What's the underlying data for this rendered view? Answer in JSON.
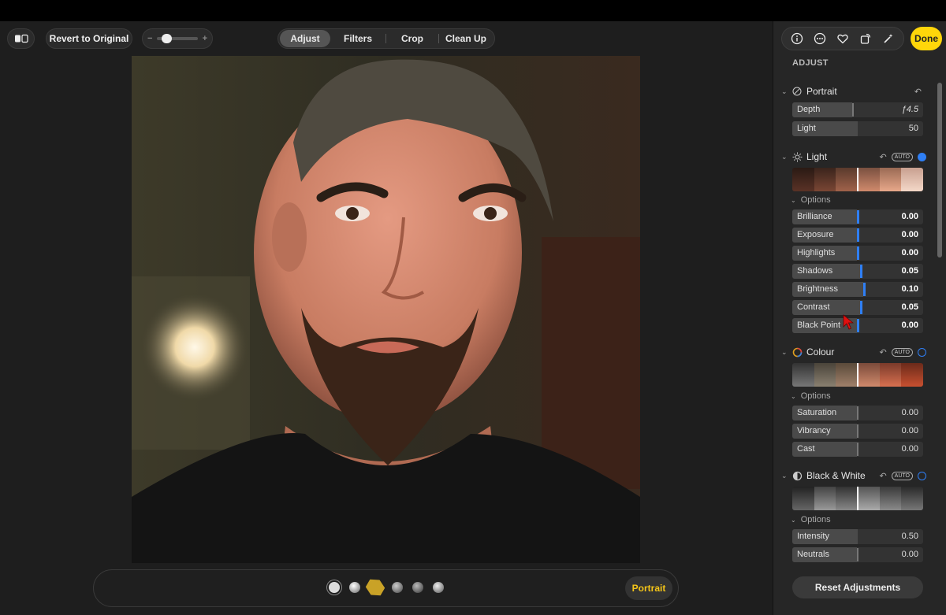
{
  "toolbar": {
    "revert_label": "Revert to Original",
    "tabs": [
      "Adjust",
      "Filters",
      "Crop",
      "Clean Up"
    ],
    "active_tab": "Adjust",
    "zoom_minus": "−",
    "zoom_plus": "+"
  },
  "sidebar": {
    "done_label": "Done",
    "icons": [
      "info-icon",
      "more-icon",
      "heart-icon",
      "rotate-icon",
      "magic-wand-icon"
    ],
    "title": "ADJUST",
    "portrait": {
      "title": "Portrait",
      "sliders": [
        {
          "label": "Depth",
          "value": "ƒ4.5"
        },
        {
          "label": "Light",
          "value": "50"
        }
      ]
    },
    "light": {
      "title": "Light",
      "auto": "AUTO",
      "options": "Options",
      "sliders": [
        {
          "label": "Brilliance",
          "value": "0.00"
        },
        {
          "label": "Exposure",
          "value": "0.00"
        },
        {
          "label": "Highlights",
          "value": "0.00"
        },
        {
          "label": "Shadows",
          "value": "0.05"
        },
        {
          "label": "Brightness",
          "value": "0.10"
        },
        {
          "label": "Contrast",
          "value": "0.05"
        },
        {
          "label": "Black Point",
          "value": "0.00"
        }
      ]
    },
    "colour": {
      "title": "Colour",
      "auto": "AUTO",
      "options": "Options",
      "sliders": [
        {
          "label": "Saturation",
          "value": "0.00"
        },
        {
          "label": "Vibrancy",
          "value": "0.00"
        },
        {
          "label": "Cast",
          "value": "0.00"
        }
      ]
    },
    "bw": {
      "title": "Black & White",
      "auto": "AUTO",
      "options": "Options",
      "sliders": [
        {
          "label": "Intensity",
          "value": "0.50"
        },
        {
          "label": "Neutrals",
          "value": "0.00"
        }
      ]
    },
    "reset_label": "Reset Adjustments"
  },
  "bottom": {
    "portrait_label": "Portrait"
  },
  "colors": {
    "accent_blue": "#2f7ff5",
    "done_yellow": "#ffd60a",
    "portrait_yellow": "#f5c518"
  }
}
